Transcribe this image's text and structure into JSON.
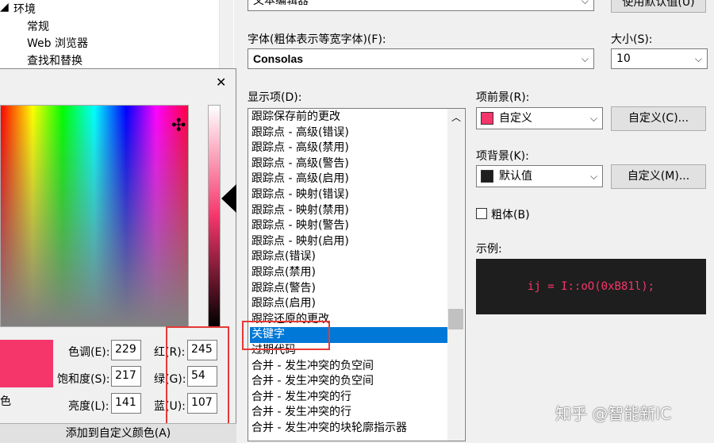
{
  "tree": {
    "items": [
      "环境",
      "常规",
      "Web 浏览器",
      "查找和替换"
    ]
  },
  "dialog": {
    "close": "✕",
    "crosshair": "✣",
    "hue_label": "色调(E):",
    "hue_value": "229",
    "sat_label": "饱和度(S):",
    "sat_value": "217",
    "lum_label": "亮度(L):",
    "lum_value": "141",
    "red_label": "红(R):",
    "red_value": "245",
    "green_label": "绿(G):",
    "green_value": "54",
    "blue_label": "蓝(U):",
    "blue_value": "107",
    "solid_label": "色",
    "add_custom": "添加到自定义颜色(A)",
    "swatch_color": "#f5366b"
  },
  "settings": {
    "top_combo": "文本编辑器",
    "use_default": "使用默认值(U)",
    "font_label": "字体(粗体表示等宽字体)(F):",
    "font_value": "Consolas",
    "size_label": "大小(S):",
    "size_value": "10",
    "display_label": "显示项(D):",
    "fg_label": "项前景(R):",
    "fg_value": "自定义",
    "fg_color": "#f5366b",
    "fg_custom": "自定义(C)...",
    "bg_label": "项背景(K):",
    "bg_value": "默认值",
    "bg_color": "#1e1e1e",
    "bg_custom": "自定义(M)...",
    "bold_label": "粗体(B)",
    "sample_label": "示例:",
    "sample_text": "ij = I::oO(0xB81l);"
  },
  "display_items": [
    "跟踪保存前的更改",
    "跟踪点 - 高级(错误)",
    "跟踪点 - 高级(禁用)",
    "跟踪点 - 高级(警告)",
    "跟踪点 - 高级(启用)",
    "跟踪点 - 映射(错误)",
    "跟踪点 - 映射(禁用)",
    "跟踪点 - 映射(警告)",
    "跟踪点 - 映射(启用)",
    "跟踪点(错误)",
    "跟踪点(禁用)",
    "跟踪点(警告)",
    "跟踪点(启用)",
    "跟踪还原的更改",
    "关键字",
    "过期代码",
    "合并 - 发生冲突的负空间",
    "合并 - 发生冲突的负空间",
    "合并 - 发生冲突的行",
    "合并 - 发生冲突的行",
    "合并 - 发生冲突的块轮廓指示器"
  ],
  "selected_index": 14,
  "watermark": "知乎 @智能新IC"
}
